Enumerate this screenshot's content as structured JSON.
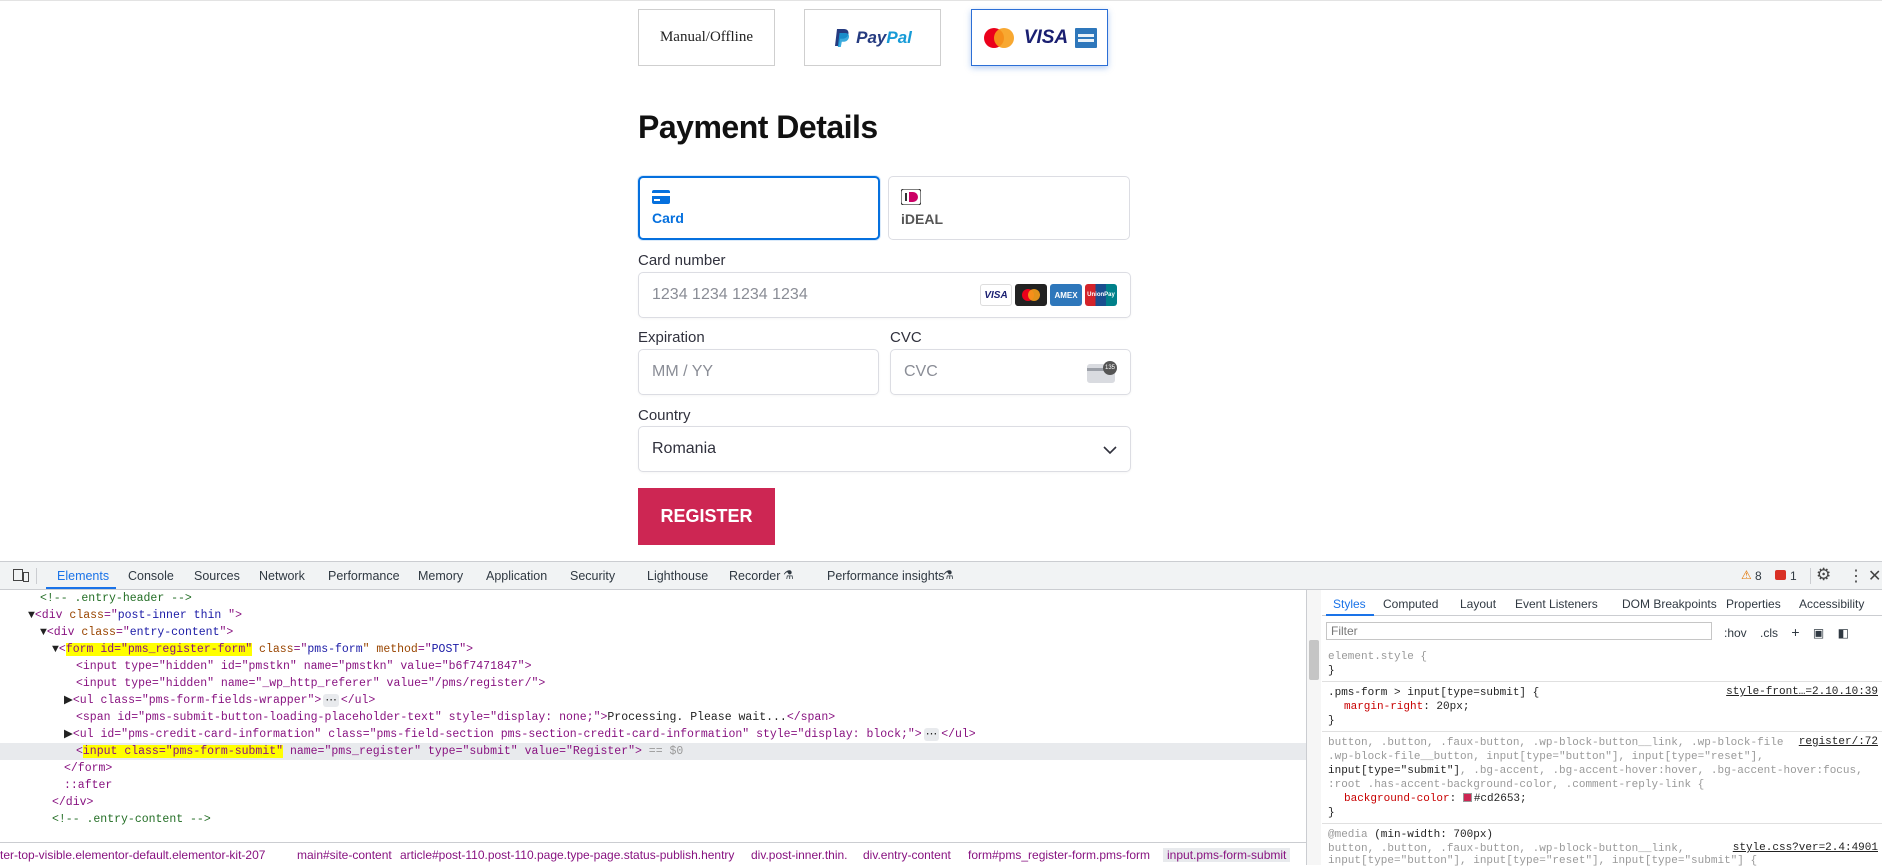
{
  "gateways": {
    "manual_label": "Manual/Offline",
    "paypal_a": "Pay",
    "paypal_b": "Pal",
    "cards_visa": "VISA"
  },
  "heading": "Payment Details",
  "methods": {
    "card_label": "Card",
    "ideal_label": "iDEAL"
  },
  "card": {
    "number_label": "Card number",
    "number_placeholder": "1234 1234 1234 1234",
    "brands": [
      "VISA",
      "",
      "AMEX",
      "UnionPay"
    ],
    "expiration_label": "Expiration",
    "expiration_placeholder": "MM / YY",
    "cvc_label": "CVC",
    "cvc_placeholder": "CVC",
    "cvc_icon_text": "135",
    "country_label": "Country",
    "country_value": "Romania"
  },
  "register_label": "REGISTER",
  "devtools": {
    "tabs": [
      "Elements",
      "Console",
      "Sources",
      "Network",
      "Performance",
      "Memory",
      "Application",
      "Security",
      "Lighthouse",
      "Recorder",
      "Performance insights"
    ],
    "warnings": "8",
    "errors": "1",
    "dom": {
      "l1": "<!-- .entry-header -->",
      "l2a": "<div ",
      "l2b": "class",
      "l2c": "=\"",
      "l2d": "post-inner thin ",
      "l2e": "\">",
      "l3a": "<div ",
      "l3b": "class",
      "l3c": "=\"",
      "l3d": "entry-content",
      "l3e": "\">",
      "l4hl": "form id=\"pms_register-form\"",
      "l4b": " class",
      "l4c": "=\"",
      "l4d": "pms-form",
      "l4e": "\" method",
      "l4f": "=\"",
      "l4g": "POST",
      "l4h": "\">",
      "l5": "<input type=\"hidden\" id=\"pmstkn\" name=\"pmstkn\" value=\"b6f7471847\">",
      "l6": "<input type=\"hidden\" name=\"_wp_http_referer\" value=\"/pms/register/\">",
      "l7": "<ul class=\"pms-form-fields-wrapper\">",
      "l7b": "</ul>",
      "l8": "<span id=\"pms-submit-button-loading-placeholder-text\" style=\"display: none;\">",
      "l8t": "Processing. Please wait...",
      "l8e": "</span>",
      "l9": "<ul id=\"pms-credit-card-information\" class=\"pms-field-section pms-section-credit-card-information\" style=\"display: block;\">",
      "l9b": "</ul>",
      "l10hl": "input class=\"pms-form-submit\"",
      "l10b": " name=\"pms_register\" type=\"submit\" value=\"Register\">",
      "l10c": " == $0",
      "l11": "</form>",
      "l12": "::after",
      "l13": "</div>",
      "l14": "<!-- .entry-content -->"
    },
    "breadcrumbs": [
      "ter-top-visible.elementor-default.elementor-kit-207",
      "main#site-content",
      "article#post-110.post-110.page.type-page.status-publish.hentry",
      "div.post-inner.thin.",
      "div.entry-content",
      "form#pms_register-form.pms-form",
      "input.pms-form-submit"
    ],
    "side_tabs": [
      "Styles",
      "Computed",
      "Layout",
      "Event Listeners",
      "DOM Breakpoints",
      "Properties",
      "Accessibility"
    ],
    "filter_placeholder": "Filter",
    "hov": ":hov",
    "cls": ".cls",
    "styles": {
      "r0": "element.style {",
      "r0e": "}",
      "r1sel": ".pms-form > input[type=submit] {",
      "r1src": "style-front…=2.10.10:39",
      "r1prop": "margin-right",
      "r1val": ": 20px;",
      "r1e": "}",
      "r2a": "button, .button, .faux-button, .wp-block-button__link, .wp-block-file",
      "r2src": "register/:72",
      "r2b": ".wp-block-file__button, input[type=\"button\"], input[type=\"reset\"],",
      "r2c1": "input[type=\"submit\"]",
      "r2c2": ", .bg-accent, .bg-accent-hover:hover, .bg-accent-hover:focus,",
      "r2d": ":root .has-accent-background-color, .comment-reply-link {",
      "r2prop": "background-color",
      "r2val": "#cd2653;",
      "r2e": "}",
      "r3a": "@media",
      "r3b": " (min-width: 700px)",
      "r3src": "style.css?ver=2.4:4901",
      "r3c": "button, .button, .faux-button, .wp-block-button__link,",
      "r3d": "input[type=\"button\"], input[type=\"reset\"], input[type=\"submit\"] {"
    }
  },
  "colors": {
    "accent": "#cd2653",
    "stripe_blue": "#0570de",
    "devtools_blue": "#1a73e8"
  }
}
